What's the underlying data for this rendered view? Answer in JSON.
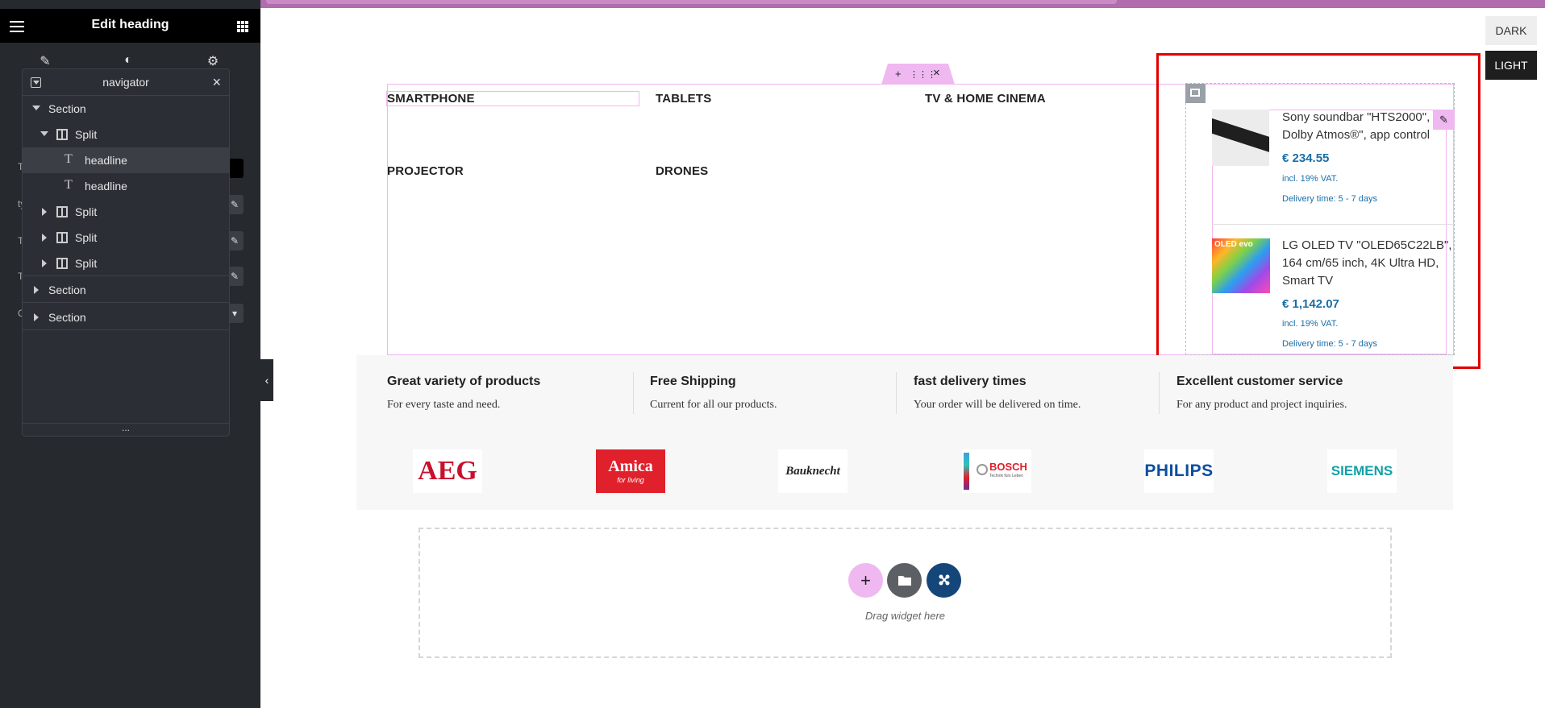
{
  "panel": {
    "title": "Edit heading",
    "tabs": [
      "content-pencil-icon",
      "style-contrast-icon",
      "advanced-gear-icon"
    ]
  },
  "navigator": {
    "title": "navigator",
    "items": [
      {
        "label": "Section"
      },
      {
        "label": "Split"
      },
      {
        "label": "headline"
      },
      {
        "label": "headline"
      },
      {
        "label": "Split"
      },
      {
        "label": "Split"
      },
      {
        "label": "Split"
      },
      {
        "label": "Section"
      },
      {
        "label": "Section"
      }
    ],
    "footer": "..."
  },
  "theme": {
    "dark": "DARK",
    "light": "LIGHT"
  },
  "section_handle": {
    "add": "+",
    "move": "⋮⋮⋮",
    "close": "×"
  },
  "categories": [
    "SMARTPHONE",
    "TABLETS",
    "TV & HOME CINEMA",
    "PROJECTOR",
    "DRONES"
  ],
  "products": [
    {
      "name_line1": "Sony soundbar \"HTS2000\",",
      "name_line2": "Dolby Atmos®\", app control",
      "price": "€ 234.55",
      "vat": "incl. 19% VAT.",
      "delivery": "Delivery time: 5 - 7 days"
    },
    {
      "name_line1": "LG OLED TV \"OLED65C22LB\",",
      "name_line2": "164 cm/65 inch, 4K Ultra HD,",
      "name_line3": "Smart TV",
      "image_text": "OLED evo",
      "price": "€ 1,142.07",
      "vat": "incl. 19% VAT.",
      "delivery": "Delivery time: 5 - 7 days"
    }
  ],
  "features": [
    {
      "title": "Great variety of products",
      "desc": "For every taste and need."
    },
    {
      "title": "Free Shipping",
      "desc": "Current for all our products."
    },
    {
      "title": "fast delivery times",
      "desc": "Your order will be delivered on time."
    },
    {
      "title": "Excellent customer service",
      "desc": "For any product and project inquiries."
    }
  ],
  "brands": [
    "AEG",
    "Amica",
    "for living",
    "Bauknecht",
    "BOSCH",
    "Technik fürs Leben",
    "PHILIPS",
    "SIEMENS"
  ],
  "dropzone": {
    "label": "Drag widget here",
    "add": "+"
  },
  "colors": {
    "accent_pink": "#f0b8f0",
    "price_blue": "#1a6ea8",
    "highlight_red": "#e10000"
  }
}
